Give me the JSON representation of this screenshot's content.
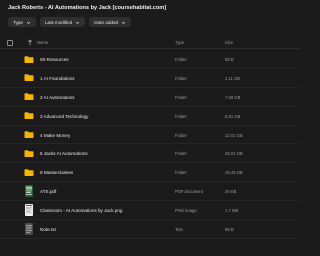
{
  "title": "Jack Roberts - AI Automations by Jack [coursehabitat.com]",
  "filters": [
    {
      "label": "Type"
    },
    {
      "label": "Last modified"
    },
    {
      "label": "Date added"
    }
  ],
  "columns": {
    "name": "Name",
    "type": "Type",
    "size": "Size"
  },
  "rows": [
    {
      "name": "00-Resources",
      "type": "Folder",
      "size": "58 B",
      "icon": "folder-icon"
    },
    {
      "name": "1 AI Foundations",
      "type": "Folder",
      "size": "2.11 GB",
      "icon": "folder-icon"
    },
    {
      "name": "2 AI Automations",
      "type": "Folder",
      "size": "7.68 GB",
      "icon": "folder-icon"
    },
    {
      "name": "3 Advanced Technology",
      "type": "Folder",
      "size": "5.81 GB",
      "icon": "folder-icon"
    },
    {
      "name": "4 Make Money",
      "type": "Folder",
      "size": "12.01 GB",
      "icon": "folder-icon"
    },
    {
      "name": "5 Jacks AI Automations",
      "type": "Folder",
      "size": "28.01 GB",
      "icon": "folder-icon"
    },
    {
      "name": "6 Masterclasses",
      "type": "Folder",
      "size": "19.43 GB",
      "icon": "folder-icon"
    },
    {
      "name": "ATS.pdf",
      "type": "PDF document",
      "size": "29 KB",
      "icon": "pdf-thumbnail-icon"
    },
    {
      "name": "Classroom - AI Automations by Jack.png",
      "type": "PNG image",
      "size": "1.7 MB",
      "icon": "png-thumbnail-icon"
    },
    {
      "name": "Note.txt",
      "type": "Text",
      "size": "89 B",
      "icon": "text-file-icon"
    }
  ],
  "colors": {
    "background": "#1b1b1b",
    "folder": "#f5b400",
    "chip": "#2f2f2f"
  }
}
